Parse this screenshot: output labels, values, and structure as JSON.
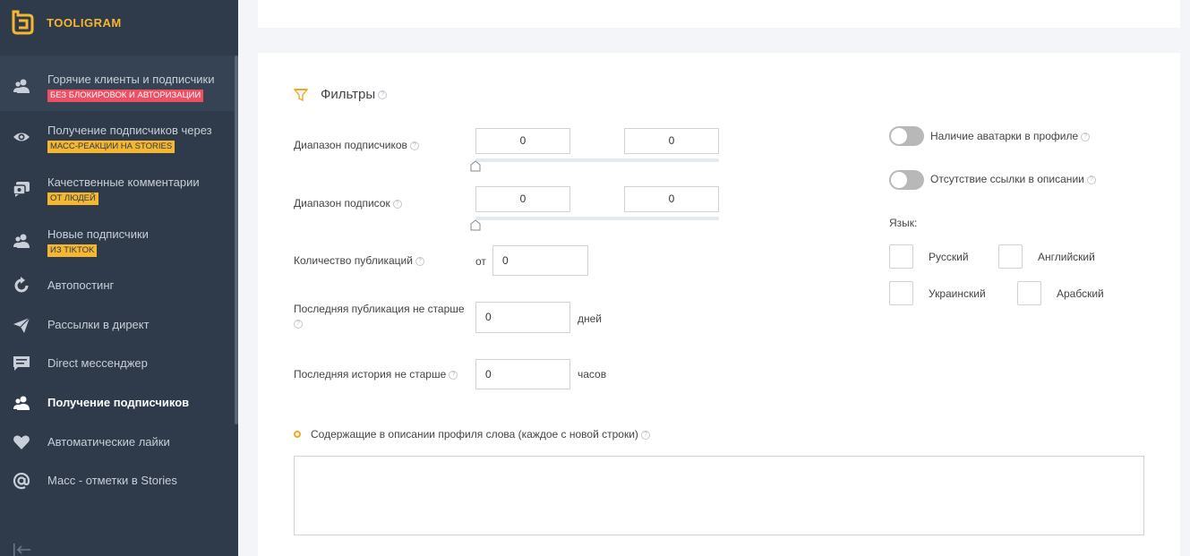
{
  "app": {
    "name": "TOOLIGRAM"
  },
  "sidebar": {
    "items": [
      {
        "label": "Горячие клиенты и подписчики",
        "badge": "БЕЗ БЛОКИРОВОК И АВТОРИЗАЦИИ",
        "icon": "users-icon"
      },
      {
        "label": "Получение подписчиков через",
        "badge": "МАСС-РЕАКЦИИ НА STORIES",
        "icon": "eye-icon"
      },
      {
        "label": "Качественные комментарии",
        "badge": "ОТ ЛЮДЕЙ",
        "icon": "comments-icon"
      },
      {
        "label": "Новые подписчики",
        "badge": "ИЗ TIKTOK",
        "icon": "users-icon"
      },
      {
        "label": "Автопостинг",
        "icon": "refresh-icon"
      },
      {
        "label": "Рассылки в директ",
        "icon": "send-icon"
      },
      {
        "label": "Direct мессенджер",
        "icon": "message-icon"
      },
      {
        "label": "Получение подписчиков",
        "icon": "users-icon"
      },
      {
        "label": "Автоматические лайки",
        "icon": "heart-icon"
      },
      {
        "label": "Масс - отметки в Stories",
        "icon": "at-icon"
      }
    ]
  },
  "filters": {
    "title": "Фильтры",
    "followers_range": {
      "label": "Диапазон подписчиков",
      "min": "0",
      "max": "0"
    },
    "following_range": {
      "label": "Диапазон подписок",
      "min": "0",
      "max": "0"
    },
    "posts_count": {
      "label": "Количество публикаций",
      "prefix": "от",
      "value": "0"
    },
    "last_post": {
      "label": "Последняя публикация не старше",
      "value": "0",
      "unit": "дней"
    },
    "last_story": {
      "label": "Последняя история не старше",
      "value": "0",
      "unit": "часов"
    },
    "toggles": {
      "avatar": "Наличие аватарки в профиле",
      "no_link": "Отсутствие ссылки в описании"
    },
    "language": {
      "label": "Язык:",
      "options": [
        "Русский",
        "Английский",
        "Украинский",
        "Арабский"
      ]
    },
    "bio_words": {
      "label": "Содержащие в описании профиля слова (каждое с новой строки)"
    }
  }
}
